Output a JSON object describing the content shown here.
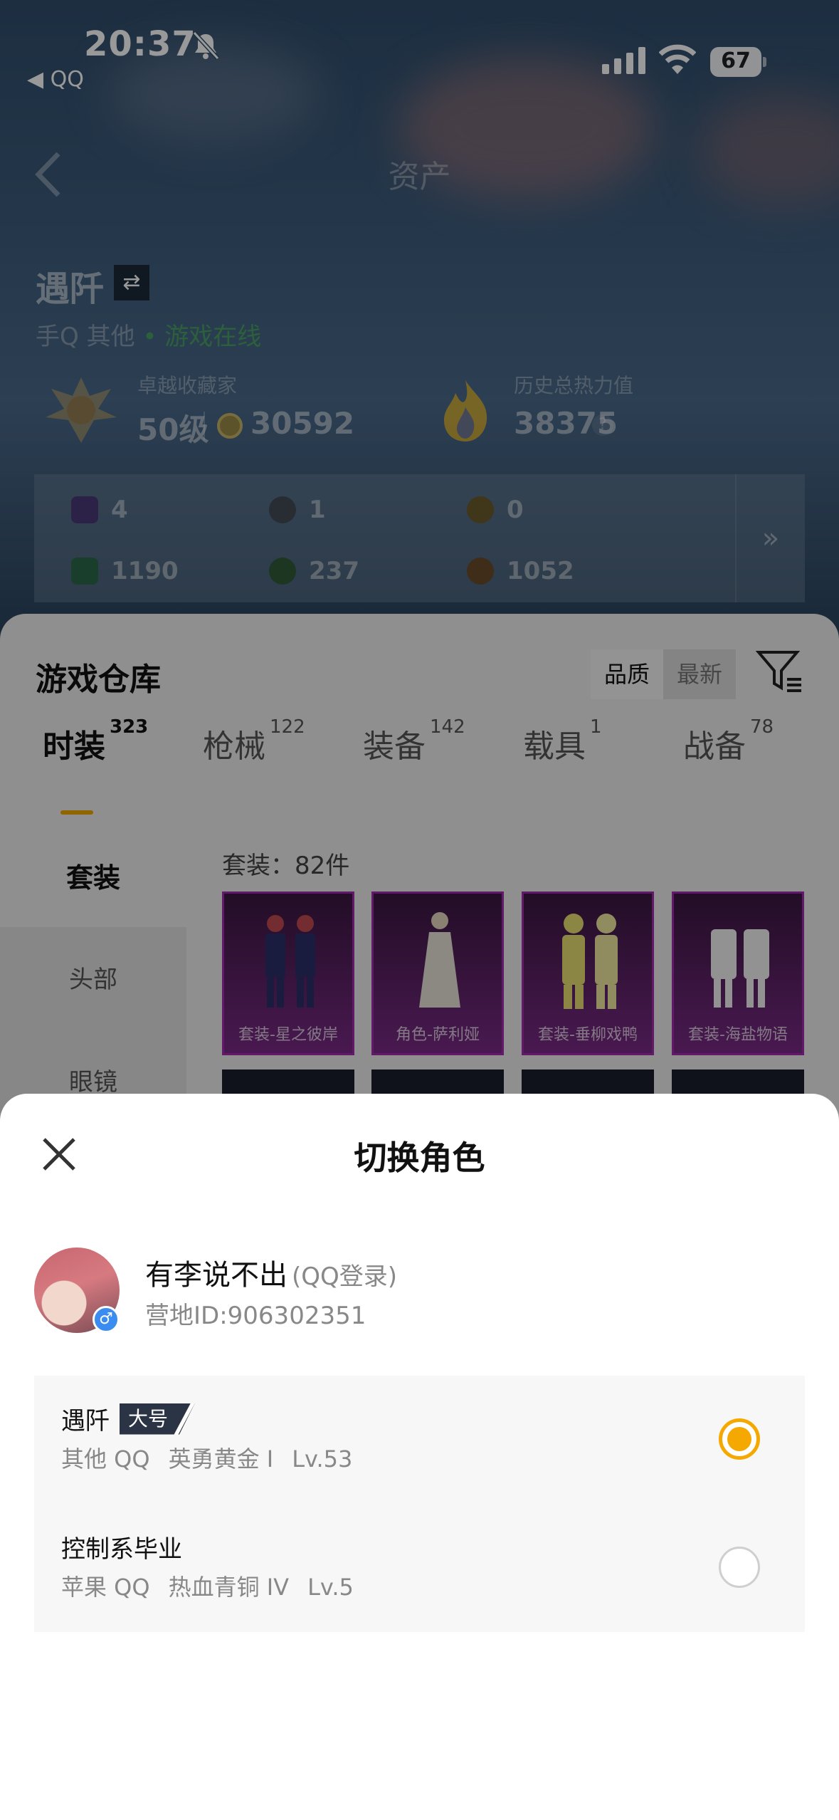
{
  "status_bar": {
    "time": "20:37",
    "back_app": "◀ QQ",
    "battery": "67"
  },
  "nav": {
    "title": "资产"
  },
  "profile": {
    "name": "遇阡",
    "swap_icon": "⇄",
    "platform": "手Q 其他",
    "online": "• 游戏在线",
    "rank_title": "卓越收藏家",
    "rank_level": "50级",
    "coins": "30592",
    "heat_label": "历史总热力值",
    "heat_value": "38375",
    "heat_help": "?"
  },
  "stats": [
    {
      "value": "4",
      "color": "#4a3a78"
    },
    {
      "value": "1",
      "color": "#444a55"
    },
    {
      "value": "0",
      "color": "#6b5a2a"
    },
    {
      "value": "1190",
      "color": "#2a6a4a"
    },
    {
      "value": "237",
      "color": "#2f5a3a"
    },
    {
      "value": "1052",
      "color": "#6a4a2a"
    }
  ],
  "stats_more": "»",
  "warehouse": {
    "title": "游戏仓库",
    "sort_quality": "品质",
    "sort_newest": "最新",
    "tabs": [
      {
        "label": "时装",
        "count": "323"
      },
      {
        "label": "枪械",
        "count": "122"
      },
      {
        "label": "装备",
        "count": "142"
      },
      {
        "label": "载具",
        "count": "1"
      },
      {
        "label": "战备",
        "count": "78"
      }
    ],
    "side": [
      "套装",
      "头部",
      "眼镜"
    ],
    "set_count": "套装：82件",
    "items": [
      "套装-星之彼岸",
      "角色-萨利娅",
      "套装-垂柳戏鸭",
      "套装-海盐物语"
    ]
  },
  "sheet": {
    "title": "切换角色",
    "account_name": "有李说不出",
    "login_type": "(QQ登录)",
    "camp_id": "营地ID:906302351",
    "gender": "♂",
    "roles": [
      {
        "name": "遇阡",
        "tag": "大号",
        "platform": "其他 QQ",
        "rank": "英勇黄金 I",
        "level": "Lv.53",
        "selected": true
      },
      {
        "name": "控制系毕业",
        "tag": "",
        "platform": "苹果 QQ",
        "rank": "热血青铜 IV",
        "level": "Lv.5",
        "selected": false
      }
    ]
  },
  "colors": {
    "accent": "#f5a800",
    "item_border": "#a52bb0",
    "online": "#4cc850"
  }
}
